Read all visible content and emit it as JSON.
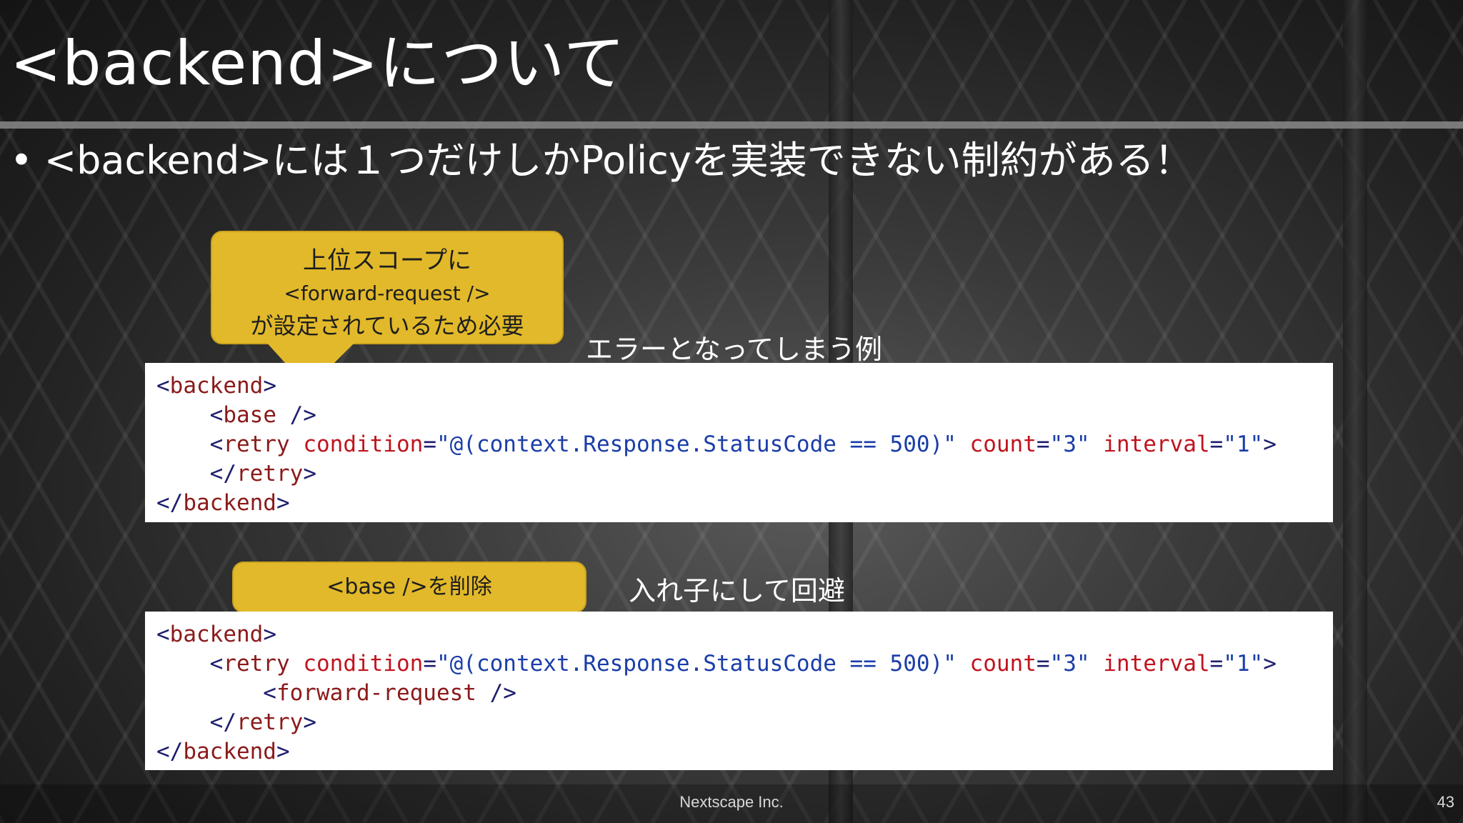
{
  "slide": {
    "title": "<backend>について",
    "bullet": "<backend>には１つだけしかPolicyを実装できない制約がある！",
    "footer_company": "Nextscape Inc.",
    "page_number": "43"
  },
  "callout_1": {
    "line1": "上位スコープに",
    "line2": "<forward-request />",
    "line3": "が設定されているため必要"
  },
  "callout_2": {
    "text": "<base />を削除"
  },
  "example_error": {
    "label": "エラーとなってしまう例",
    "lines": [
      [
        {
          "t": "<",
          "c": "punct"
        },
        {
          "t": "backend",
          "c": "tag"
        },
        {
          "t": ">",
          "c": "punct"
        }
      ],
      [
        {
          "t": "    <",
          "c": "punct"
        },
        {
          "t": "base",
          "c": "tag"
        },
        {
          "t": " />",
          "c": "punct"
        }
      ],
      [
        {
          "t": "    <",
          "c": "punct"
        },
        {
          "t": "retry",
          "c": "tag"
        },
        {
          "t": " ",
          "c": "punct"
        },
        {
          "t": "condition",
          "c": "attr"
        },
        {
          "t": "=",
          "c": "punct"
        },
        {
          "t": "\"@(context.Response.StatusCode == 500)\"",
          "c": "val"
        },
        {
          "t": " ",
          "c": "punct"
        },
        {
          "t": "count",
          "c": "attr"
        },
        {
          "t": "=",
          "c": "punct"
        },
        {
          "t": "\"3\"",
          "c": "val"
        },
        {
          "t": " ",
          "c": "punct"
        },
        {
          "t": "interval",
          "c": "attr"
        },
        {
          "t": "=",
          "c": "punct"
        },
        {
          "t": "\"1\"",
          "c": "val"
        },
        {
          "t": ">",
          "c": "punct"
        }
      ],
      [
        {
          "t": "    </",
          "c": "punct"
        },
        {
          "t": "retry",
          "c": "tag"
        },
        {
          "t": ">",
          "c": "punct"
        }
      ],
      [
        {
          "t": "</",
          "c": "punct"
        },
        {
          "t": "backend",
          "c": "tag"
        },
        {
          "t": ">",
          "c": "punct"
        }
      ]
    ]
  },
  "example_fix": {
    "label": "入れ子にして回避",
    "lines": [
      [
        {
          "t": "<",
          "c": "punct"
        },
        {
          "t": "backend",
          "c": "tag"
        },
        {
          "t": ">",
          "c": "punct"
        }
      ],
      [
        {
          "t": "    <",
          "c": "punct"
        },
        {
          "t": "retry",
          "c": "tag"
        },
        {
          "t": " ",
          "c": "punct"
        },
        {
          "t": "condition",
          "c": "attr"
        },
        {
          "t": "=",
          "c": "punct"
        },
        {
          "t": "\"@(context.Response.StatusCode == 500)\"",
          "c": "val"
        },
        {
          "t": " ",
          "c": "punct"
        },
        {
          "t": "count",
          "c": "attr"
        },
        {
          "t": "=",
          "c": "punct"
        },
        {
          "t": "\"3\"",
          "c": "val"
        },
        {
          "t": " ",
          "c": "punct"
        },
        {
          "t": "interval",
          "c": "attr"
        },
        {
          "t": "=",
          "c": "punct"
        },
        {
          "t": "\"1\"",
          "c": "val"
        },
        {
          "t": ">",
          "c": "punct"
        }
      ],
      [
        {
          "t": "        <",
          "c": "punct"
        },
        {
          "t": "forward-request",
          "c": "tag"
        },
        {
          "t": " />",
          "c": "punct"
        }
      ],
      [
        {
          "t": "    </",
          "c": "punct"
        },
        {
          "t": "retry",
          "c": "tag"
        },
        {
          "t": ">",
          "c": "punct"
        }
      ],
      [
        {
          "t": "</",
          "c": "punct"
        },
        {
          "t": "backend",
          "c": "tag"
        },
        {
          "t": ">",
          "c": "punct"
        }
      ]
    ]
  },
  "colors": {
    "callout_fill": "#e2b92a",
    "code_tag": "#8b1a1a",
    "code_attr": "#c0141e",
    "code_value": "#1a3da8",
    "code_punct": "#1e1e6e"
  }
}
